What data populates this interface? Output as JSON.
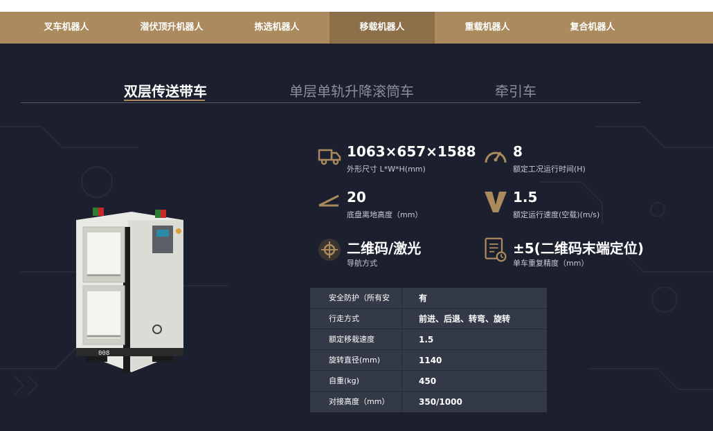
{
  "categories": [
    "叉车机器人",
    "潜伏顶升机器人",
    "拣选机器人",
    "移载机器人",
    "重载机器人",
    "复合机器人"
  ],
  "active_category": "移载机器人",
  "product_tabs": [
    "双层传送带车",
    "单层单轨升降滚筒车",
    "牵引车"
  ],
  "active_product_tab": "双层传送带车",
  "robot_badge": "008",
  "specs": [
    {
      "value": "1063×657×1588",
      "label": "外形尺寸 L*W*H(mm)",
      "icon": "truck-icon"
    },
    {
      "value": "8",
      "label": "额定工况运行时间(H)",
      "icon": "gauge-icon"
    },
    {
      "value": "20",
      "label": "底盘离地高度（mm）",
      "icon": "ground-clearance-icon"
    },
    {
      "value": "1.5",
      "label": "额定运行速度(空载)(m/s)",
      "icon": "velocity-icon"
    },
    {
      "value": "二维码/激光",
      "label": "导航方式",
      "icon": "navigation-target-icon"
    },
    {
      "value": "±5(二维码末端定位)",
      "label": "单车重复精度（mm）",
      "icon": "document-clock-icon"
    }
  ],
  "spec_table": [
    {
      "key": "安全防护（所有安",
      "value": "有"
    },
    {
      "key": "行走方式",
      "value": "前进、后退、转弯、旋转"
    },
    {
      "key": "额定移栽速度",
      "value": "1.5"
    },
    {
      "key": "旋转直径(mm)",
      "value": "1140"
    },
    {
      "key": "自重(kg)",
      "value": "450"
    },
    {
      "key": "对接高度（mm）",
      "value": "350/1000"
    }
  ],
  "colors": {
    "gold": "#ab8a5d",
    "gold_active": "#8c7049",
    "dark_bg": "#1b1f2e",
    "table_bg": "#333947"
  }
}
